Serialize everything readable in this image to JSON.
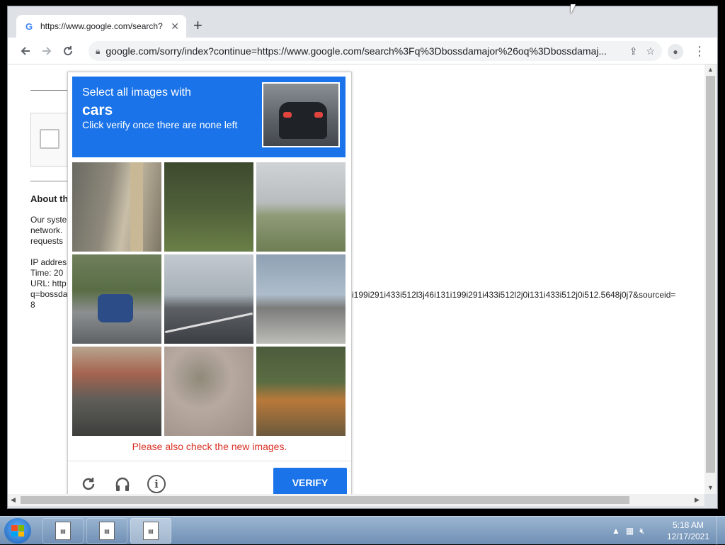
{
  "browser": {
    "tab_title": "https://www.google.com/search?",
    "tab_close": "✕",
    "new_tab": "+",
    "url": "google.com/sorry/index?continue=https://www.google.com/search%3Fq%3Dbossdamajor%26oq%3Dbossdamaj...",
    "favicon": "G"
  },
  "page": {
    "about_heading": "About th",
    "para1": "Our syste",
    "para2": "network.",
    "para3": "requests",
    "ip": "IP addres",
    "time": "Time: 20",
    "url_label": "URL: http",
    "q_line": "q=bossda",
    "eight": "8",
    "url_tail": "i199i291i433i512l3j46i131i199i291i433i512l2j0i131i433i512j0i512.5648j0j7&sourceid="
  },
  "captcha": {
    "line1": "Select all images with",
    "target": "cars",
    "line3": "Click verify once there are none left",
    "message": "Please also check the new images.",
    "verify_label": "VERIFY",
    "icons": [
      "reload-icon",
      "headphones-icon",
      "info-icon"
    ]
  },
  "taskbar": {
    "time": "5:18 AM",
    "date": "12/17/2021"
  }
}
